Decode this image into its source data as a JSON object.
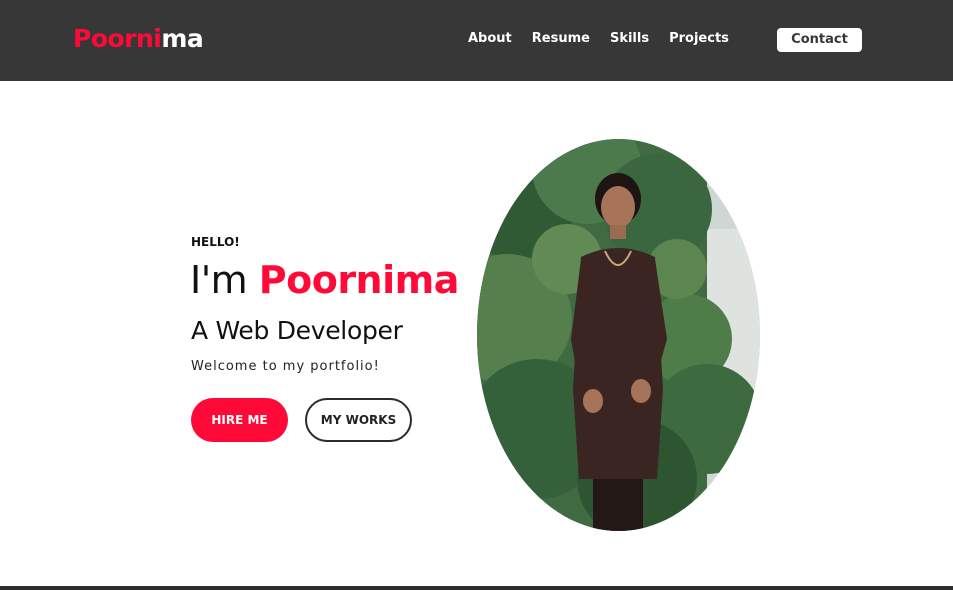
{
  "brand": {
    "logo_part_a": "Poorni",
    "logo_part_b": "ma"
  },
  "nav": {
    "links": [
      "About",
      "Resume",
      "Skills",
      "Projects"
    ],
    "contact_label": "Contact"
  },
  "hero": {
    "greeting": "HELLO!",
    "intro_prefix": "I'm ",
    "name": "Poornima",
    "role": "A Web Developer",
    "welcome": "Welcome to my portfolio!",
    "hire_label": "HIRE ME",
    "works_label": "MY WORKS"
  },
  "colors": {
    "accent": "#ff0a38",
    "navbar": "#373737"
  }
}
